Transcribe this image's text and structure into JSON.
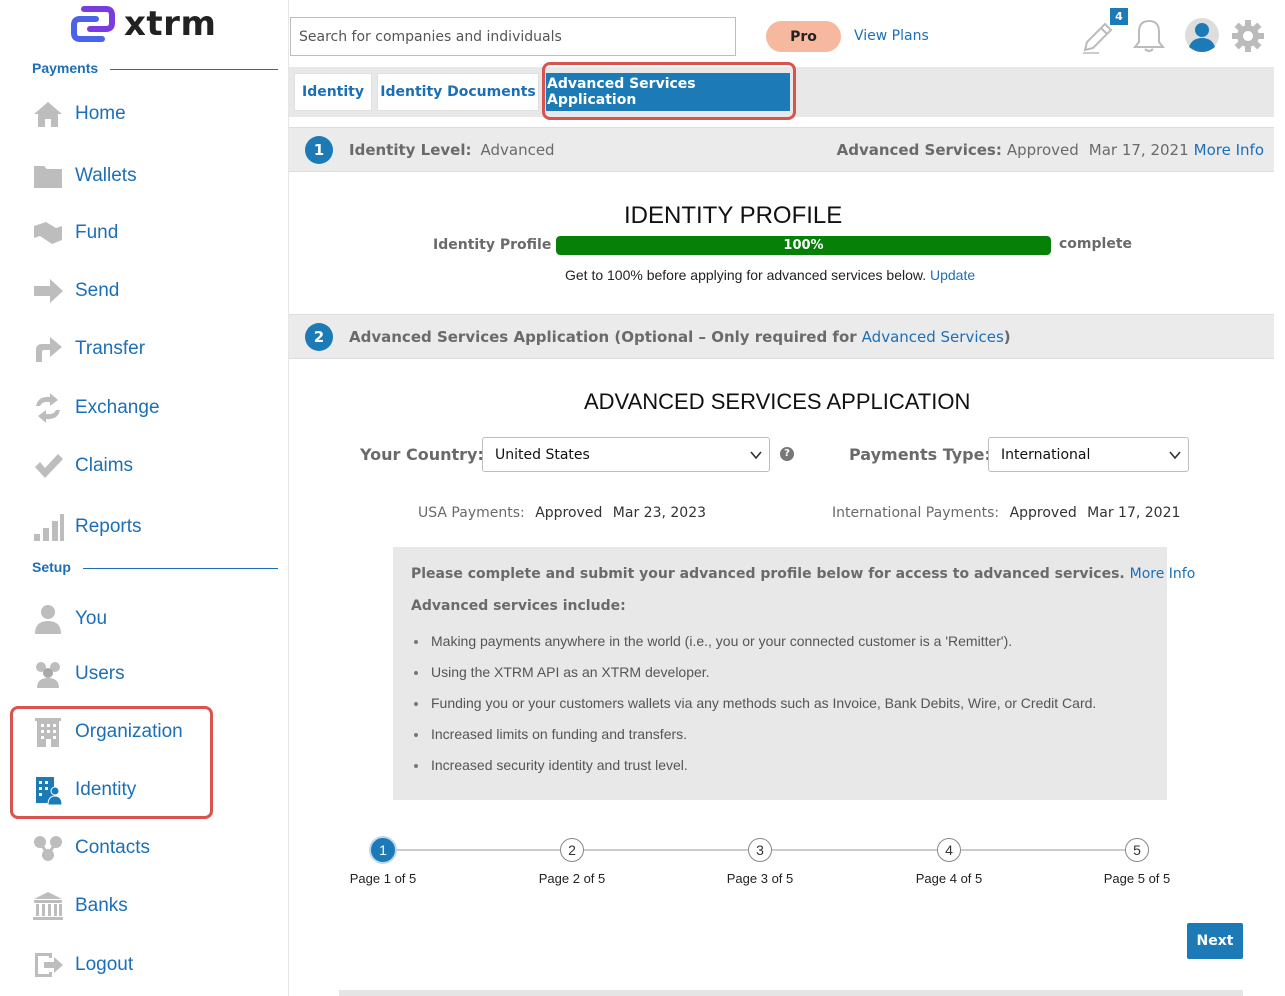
{
  "app": {
    "name": "xtrm"
  },
  "colors": {
    "accent": "#1c7ab7",
    "link": "#1c6fb7",
    "progress": "#078007",
    "pro_badge": "#f7b8a0",
    "highlight": "#d9534f"
  },
  "sidebar": {
    "sections": [
      {
        "label": "Payments"
      },
      {
        "label": "Setup"
      }
    ],
    "items": [
      {
        "label": "Home",
        "icon": "home-icon"
      },
      {
        "label": "Wallets",
        "icon": "folder-icon"
      },
      {
        "label": "Fund",
        "icon": "fund-icon"
      },
      {
        "label": "Send",
        "icon": "arrow-right-icon"
      },
      {
        "label": "Transfer",
        "icon": "transfer-icon"
      },
      {
        "label": "Exchange",
        "icon": "exchange-icon"
      },
      {
        "label": "Claims",
        "icon": "check-icon"
      },
      {
        "label": "Reports",
        "icon": "bar-chart-icon"
      },
      {
        "label": "You",
        "icon": "user-icon"
      },
      {
        "label": "Users",
        "icon": "users-icon"
      },
      {
        "label": "Organization",
        "icon": "building-icon"
      },
      {
        "label": "Identity",
        "icon": "identity-icon"
      },
      {
        "label": "Contacts",
        "icon": "contacts-icon"
      },
      {
        "label": "Banks",
        "icon": "bank-icon"
      },
      {
        "label": "Logout",
        "icon": "logout-icon"
      }
    ]
  },
  "header": {
    "search_placeholder": "Search for companies and individuals",
    "pro_label": "Pro",
    "view_plans": "View Plans",
    "notification_count": "4"
  },
  "tabs": [
    {
      "label": "Identity"
    },
    {
      "label": "Identity Documents"
    },
    {
      "label": "Advanced Services Application",
      "active": true
    }
  ],
  "identity_level": {
    "number": "1",
    "label": "Identity Level:",
    "value": "Advanced",
    "adv_label": "Advanced Services:",
    "adv_status": "Approved",
    "adv_date": "Mar 17, 2021",
    "more_info": "More Info"
  },
  "profile": {
    "title": "IDENTITY PROFILE",
    "bar_label": "Identity Profile",
    "percent": "100%",
    "percent_value": 100,
    "after": "complete",
    "note": "Get to 100% before applying for advanced services below.",
    "update": "Update"
  },
  "section2": {
    "number": "2",
    "text": "Advanced Services Application (Optional – Only required for",
    "link": "Advanced Services",
    "close": ")"
  },
  "application": {
    "title": "ADVANCED SERVICES APPLICATION",
    "country_label": "Your Country:",
    "country_value": "United States",
    "help": "?",
    "payments_label": "Payments Type:",
    "payments_value": "International",
    "usa_label": "USA Payments:",
    "usa_status": "Approved",
    "usa_date": "Mar 23, 2023",
    "intl_label": "International Payments:",
    "intl_status": "Approved",
    "intl_date": "Mar 17, 2021"
  },
  "info": {
    "main": "Please complete and submit your advanced profile below for access to advanced services.",
    "more_info": "More Info",
    "sub": "Advanced services include:",
    "bullets": [
      "Making payments anywhere in the world (i.e., you or your connected customer is a 'Remitter').",
      "Using the XTRM API as an XTRM developer.",
      "Funding you or your customers wallets via any methods such as Invoice, Bank Debits, Wire, or Credit Card.",
      "Increased limits on funding and transfers.",
      "Increased security identity and trust level."
    ]
  },
  "stepper": [
    {
      "num": "1",
      "label": "Page 1 of 5",
      "active": true
    },
    {
      "num": "2",
      "label": "Page 2 of 5"
    },
    {
      "num": "3",
      "label": "Page 3 of 5"
    },
    {
      "num": "4",
      "label": "Page 4 of 5"
    },
    {
      "num": "5",
      "label": "Page 5 of 5"
    }
  ],
  "next_label": "Next"
}
